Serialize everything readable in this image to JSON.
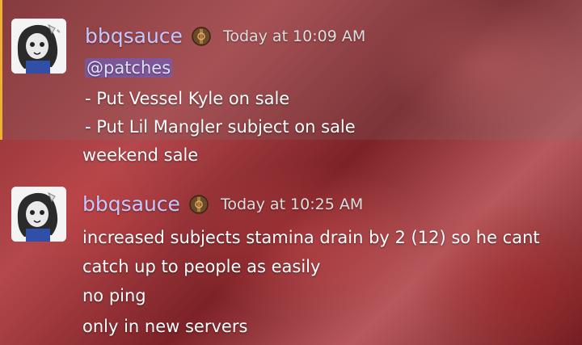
{
  "messages": [
    {
      "author": "bbqsauce",
      "timestamp": "Today at 10:09 AM",
      "mention": "@patches",
      "lines": [
        "- Put Vessel Kyle on sale",
        "- Put Lil Mangler subject on sale",
        "weekend sale"
      ],
      "highlighted": true,
      "highlight_color": "#f0b232"
    },
    {
      "author": "bbqsauce",
      "timestamp": "Today at 10:25 AM",
      "lines": [
        "increased subjects stamina drain by 2 (12) so he cant",
        "catch up to people as easily",
        "no ping",
        "only in new servers"
      ]
    }
  ],
  "colors": {
    "username": "#c5c8ff",
    "mention_bg": "#5865f2",
    "text": "#ffffff",
    "timestamp": "#dedede"
  },
  "icons": {
    "badge": "wooden-shield-badge-icon",
    "avatar": "user-avatar-anime-drawing"
  }
}
